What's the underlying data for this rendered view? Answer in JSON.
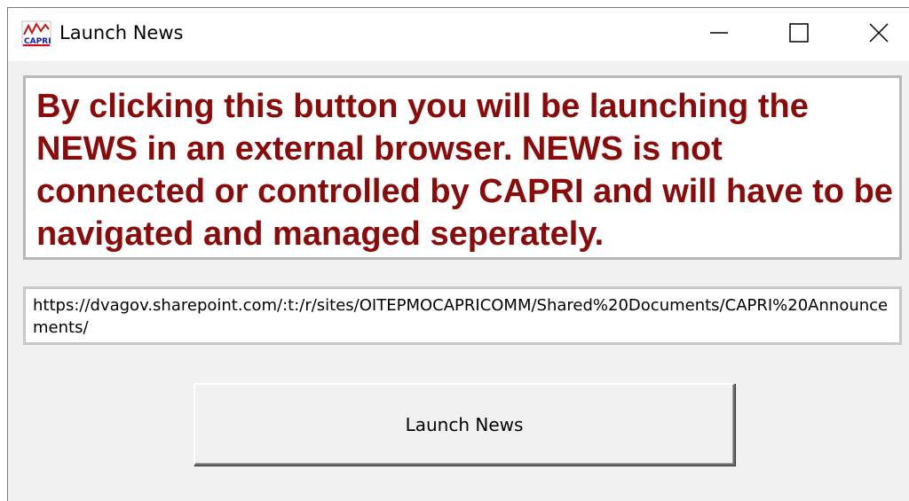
{
  "window": {
    "title": "Launch News",
    "icon": "app-logo-icon",
    "controls": {
      "minimize_icon": "minimize-icon",
      "maximize_icon": "maximize-icon",
      "close_icon": "close-icon"
    }
  },
  "message": {
    "text": "By clicking this button you will be launching the NEWS in an external browser. NEWS is not connected or controlled by CAPRI and will have to be navigated and managed seperately.",
    "color": "#8b0a0a"
  },
  "url": {
    "value": "https://dvagov.sharepoint.com/:t:/r/sites/OITEPMOCAPRICOMM/Shared%20Documents/CAPRI%20Announcements/"
  },
  "launch_button": {
    "label": "Launch News"
  }
}
